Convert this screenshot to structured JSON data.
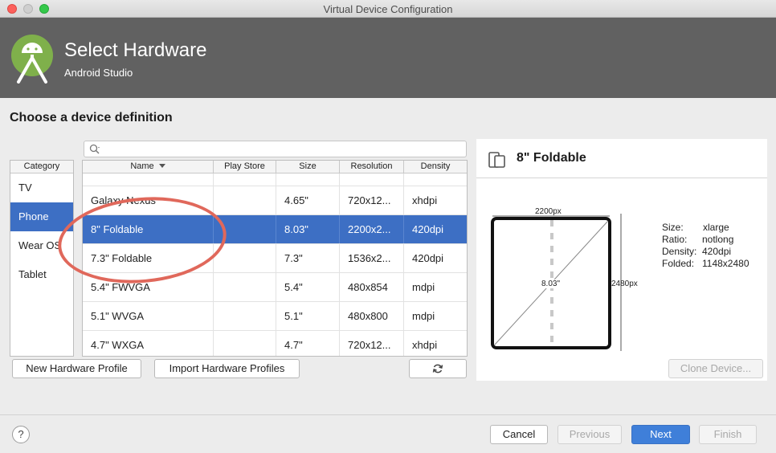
{
  "window": {
    "title": "Virtual Device Configuration"
  },
  "header": {
    "title": "Select Hardware",
    "subtitle": "Android Studio"
  },
  "section_title": "Choose a device definition",
  "search": {
    "placeholder": "",
    "value": ""
  },
  "category": {
    "header": "Category",
    "items": [
      {
        "label": "TV",
        "selected": false
      },
      {
        "label": "Phone",
        "selected": true
      },
      {
        "label": "Wear OS",
        "selected": false
      },
      {
        "label": "Tablet",
        "selected": false
      }
    ]
  },
  "table": {
    "columns": [
      "Name",
      "Play Store",
      "Size",
      "Resolution",
      "Density"
    ],
    "rows": [
      {
        "name": "Galaxy Nexus",
        "play": "",
        "size": "4.65\"",
        "res": "720x12...",
        "den": "xhdpi"
      },
      {
        "name": "8\" Foldable",
        "play": "",
        "size": "8.03\"",
        "res": "2200x2...",
        "den": "420dpi",
        "selected": true
      },
      {
        "name": "7.3\" Foldable",
        "play": "",
        "size": "7.3\"",
        "res": "1536x2...",
        "den": "420dpi"
      },
      {
        "name": "5.4\" FWVGA",
        "play": "",
        "size": "5.4\"",
        "res": "480x854",
        "den": "mdpi"
      },
      {
        "name": "5.1\" WVGA",
        "play": "",
        "size": "5.1\"",
        "res": "480x800",
        "den": "mdpi"
      },
      {
        "name": "4.7\" WXGA",
        "play": "",
        "size": "4.7\"",
        "res": "720x12...",
        "den": "xhdpi"
      }
    ]
  },
  "buttons": {
    "new_profile": "New Hardware Profile",
    "import_profiles": "Import Hardware Profiles",
    "clone": "Clone Device...",
    "cancel": "Cancel",
    "previous": "Previous",
    "next": "Next",
    "finish": "Finish",
    "help": "?"
  },
  "details": {
    "title": "8\" Foldable",
    "width_label": "2200px",
    "height_label": "2480px",
    "diagonal_label": "8.03\"",
    "specs": [
      {
        "label": "Size:",
        "value": "xlarge"
      },
      {
        "label": "Ratio:",
        "value": "notlong"
      },
      {
        "label": "Density:",
        "value": "420dpi"
      },
      {
        "label": "Folded:",
        "value": "1148x2480"
      }
    ]
  },
  "colors": {
    "accent": "#3d6fc4",
    "header_bg": "#616161",
    "highlight": "#e0685b"
  }
}
